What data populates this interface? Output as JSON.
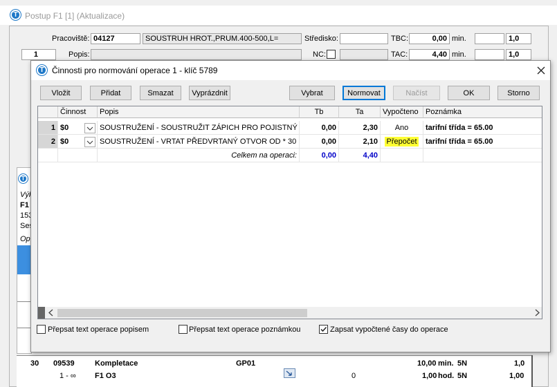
{
  "main_window": {
    "title": "Postup F1  [1] (Aktualizace)",
    "pracoviste_label": "Pracoviště:",
    "pracoviste_code": "04127",
    "pracoviste_name": "SOUSTRUH HROT.,PRUM.400-500,L=",
    "stredisko_label": "Středisko:",
    "tbc_label": "TBC:",
    "tbc_value": "0,00",
    "tbc_unit": "min.",
    "tbc_coef": "1,0",
    "op_number": "1",
    "popis_label": "Popis:",
    "nc_label": "NC:",
    "tac_label": "TAC:",
    "tac_value": "4,40",
    "tac_unit": "min.",
    "tac_coef": "1,0"
  },
  "background_panel": {
    "vyk": "Výk",
    "f1": "F1",
    "num": "153",
    "ses": "Ses",
    "op": "Op"
  },
  "bottom_rows": [
    {
      "c1": "30",
      "c2": "09539",
      "c3": "Kompletace",
      "c4": "GP01",
      "c5": "10,00",
      "c6": "min.",
      "c7": "5N",
      "c8": "1,0"
    },
    {
      "c1": "",
      "c2": "1 - ∞",
      "c3": "F1 O3",
      "c4": "0",
      "c5": "1,00",
      "c6": "hod.",
      "c7": "5N",
      "c8": "1,00"
    }
  ],
  "dialog": {
    "title": "Činnosti pro normování operace 1 - klíč 5789",
    "buttons": {
      "vlozit": "Vložit",
      "pridat": "Přidat",
      "smazat": "Smazat",
      "vyprazdnit": "Vyprázdnit",
      "vybrat": "Vybrat",
      "normovat": "Normovat",
      "nacist": "Načíst",
      "ok": "OK",
      "storno": "Storno"
    },
    "columns": {
      "cinnost": "Činnost",
      "popis": "Popis",
      "tb": "Tb",
      "ta": "Ta",
      "vypocteno": "Vypočteno",
      "poznamka": "Poznámka"
    },
    "rows": [
      {
        "idx": "1",
        "cinnost": "$0",
        "popis": "SOUSTRUŽENÍ -  SOUSTRUŽIT ZÁPICH PRO POJISTNÝ KRO",
        "tb": "0,00",
        "ta": "2,30",
        "vypocteno": "Ano",
        "poznamka": "tarifní třída = 65.00"
      },
      {
        "idx": "2",
        "cinnost": "$0",
        "popis": "SOUSTRUŽENÍ - VRTAT PŘEDVRTANÝ OTVOR OD * 30",
        "tb": "0,00",
        "ta": "2,10",
        "vypocteno": "Přepočet",
        "poznamka": "tarifní třída = 65.00"
      }
    ],
    "total": {
      "label": "Celkem na operaci:",
      "tb": "0,00",
      "ta": "4,40"
    },
    "checkboxes": {
      "prepsat_popisem": {
        "label": "Přepsat text operace popisem",
        "checked": false
      },
      "prepsat_poznamkou": {
        "label": "Přepsat text operace poznámkou",
        "checked": false
      },
      "zapsat_casy": {
        "label": "Zapsat vypočtené časy do operace",
        "checked": true
      }
    },
    "colors": {
      "highlight": "#ffff33",
      "total_blue": "#0000c8"
    }
  }
}
